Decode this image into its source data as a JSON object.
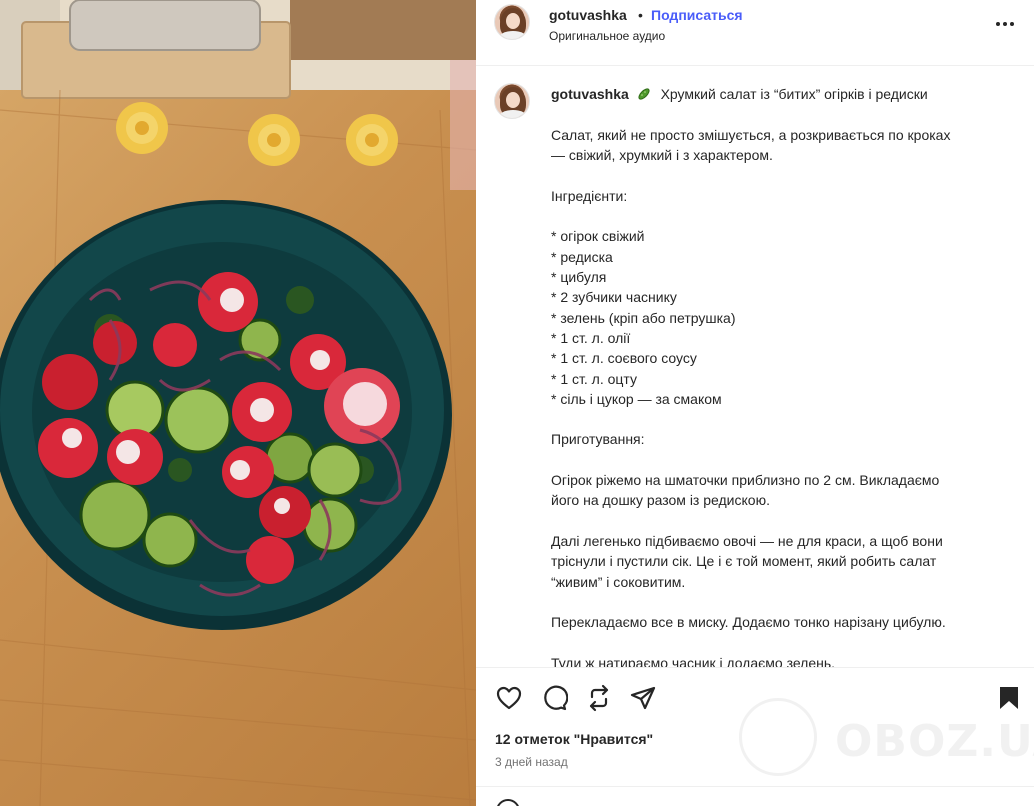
{
  "header": {
    "username": "gotuvashka",
    "separator": "•",
    "follow_label": "Подписаться",
    "audio_label": "Оригинальное аудио",
    "more_icon": "more-horizontal-icon"
  },
  "caption": {
    "username": "gotuvashka",
    "title_emoji_icon": "cucumber-icon",
    "title": "Хрумкий салат із “битих” огірків і редиски",
    "lines": [
      "Салат, який не просто змішується, а розкривається по кроках",
      "— свіжий, хрумкий і з характером.",
      "",
      "Інгредієнти:",
      "",
      "* огірок свіжий",
      "* редиска",
      "* цибуля",
      "* 2 зубчики часнику",
      "* зелень (кріп або петрушка)",
      "* 1 ст. л. олії",
      "* 1 ст. л. соєвого соусу",
      "* 1 ст. л. оцту",
      "* сіль і цукор — за смаком",
      "",
      "Приготування:",
      "",
      "Огірок ріжемо на шматочки приблизно по 2 см. Викладаємо",
      "його на дошку разом із редискою.",
      "",
      "Далі легенько підбиваємо овочі — не для краси, а щоб вони",
      "тріснули і пустили сік. Це і є той момент, який робить салат",
      "“живим” і соковитим.",
      "",
      "Перекладаємо все в миску. Додаємо тонко нарізану цибулю.",
      "",
      "Туди ж натираємо часник і додаємо зелень."
    ]
  },
  "actions": {
    "like_icon": "heart-icon",
    "comment_icon": "comment-icon",
    "repost_icon": "repost-icon",
    "share_icon": "share-icon",
    "save_icon": "bookmark-icon",
    "likes_text": "12 отметок \"Нравится\"",
    "posted_text": "3 дней назад"
  },
  "watermark": {
    "text": "OBOZ.UA"
  },
  "colors": {
    "follow_blue": "#4a5df9",
    "text_dark": "#262626",
    "text_muted": "#737373",
    "bowl_teal": "#12474a",
    "board_wood": "#c88f4f"
  }
}
